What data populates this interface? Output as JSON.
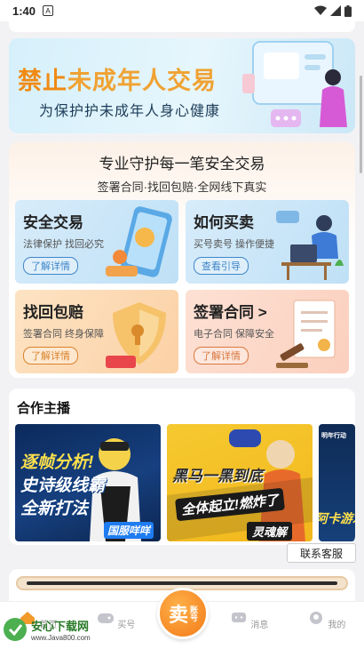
{
  "status_bar": {
    "time": "1:40",
    "notif_glyph": "A"
  },
  "banner": {
    "title_pre": "禁止",
    "title_rest": "未成年人交易",
    "subtitle": "为保护护未成年人身心健康"
  },
  "safe_section": {
    "heading": "专业守护每一笔安全交易",
    "subheading": "签署合同·找回包赔·全网线下真实",
    "tiles": [
      {
        "title": "安全交易",
        "desc": "法律保护 找回必究",
        "button": "了解详情"
      },
      {
        "title": "如何买卖",
        "desc": "买号卖号 操作便捷",
        "button": "查看引导"
      },
      {
        "title": "找回包赔",
        "desc": "签署合同 终身保障",
        "button": "了解详情"
      },
      {
        "title": "签署合同 >",
        "desc": "电子合同 保障安全",
        "button": "了解详情"
      }
    ]
  },
  "partners": {
    "heading": "合作主播",
    "cards": [
      {
        "line1": "逐帧分析!",
        "line2": "史诗级线霸",
        "line3": "全新打法",
        "tag": "国服咩咩"
      },
      {
        "line1": "黑马一黑到底",
        "line2": "全体起立!燃炸了",
        "tag": "灵魂解"
      },
      {
        "top": "明年行动",
        "tag": "阿卡游戏"
      }
    ]
  },
  "service_button": "联系客服",
  "tabbar": {
    "tabs": [
      {
        "label": "首页"
      },
      {
        "label": "买号"
      },
      {
        "label": "消息"
      },
      {
        "label": "我的"
      }
    ],
    "sell_big": "卖",
    "sell_small": "账号"
  },
  "watermark": {
    "name": "安心下载网",
    "url": "www.Java800.com"
  },
  "colors": {
    "accent": "#f27a17",
    "brand_blue": "#3f86c9"
  }
}
